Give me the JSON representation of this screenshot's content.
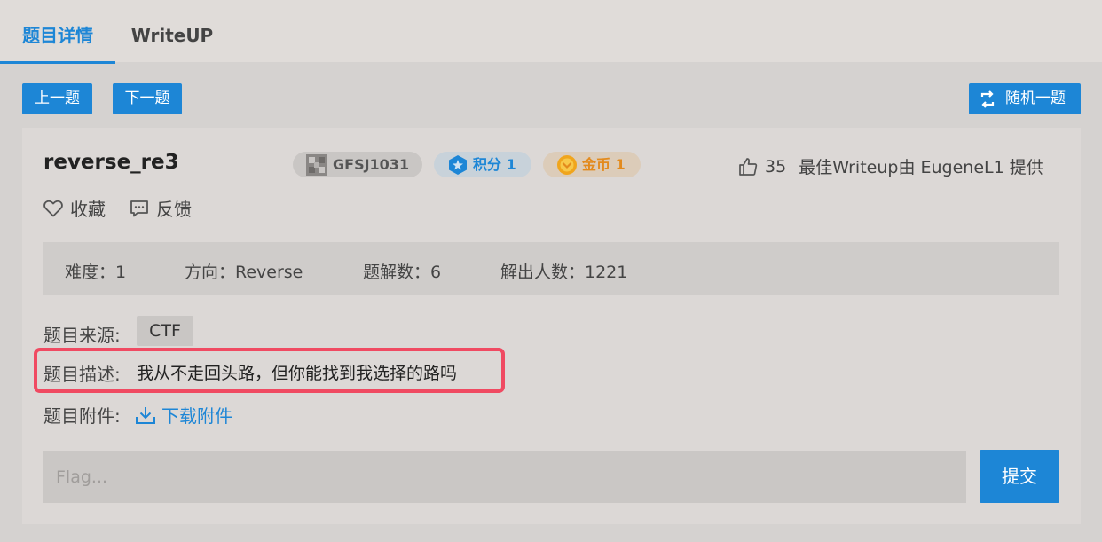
{
  "tabs": [
    {
      "label": "题目详情",
      "active": true
    },
    {
      "label": "WriteUP",
      "active": false
    }
  ],
  "nav": {
    "prev_label": "上一题",
    "next_label": "下一题",
    "random_label": "随机一题"
  },
  "challenge": {
    "title": "reverse_re3",
    "id": "GFSJ1031",
    "score": "积分 1",
    "coins": "金币 1",
    "likes": "35",
    "best_writeup": "最佳Writeup由 EugeneL1 提供"
  },
  "actions": {
    "favorite_label": "收藏",
    "feedback_label": "反馈"
  },
  "info": {
    "difficulty": "难度：1",
    "direction": "方向：Reverse",
    "solves": "题解数：6",
    "solvers": "解出人数：1221"
  },
  "details": {
    "source_label": "题目来源:",
    "source_value": "CTF",
    "desc_label": "题目描述:",
    "desc_value": "我从不走回头路，但你能找到我选择的路吗",
    "attach_label": "题目附件:",
    "download_label": "下载附件"
  },
  "submit": {
    "placeholder": "Flag...",
    "button_label": "提交"
  },
  "colors": {
    "accent": "#1d86d6",
    "highlight": "#f04a62"
  }
}
